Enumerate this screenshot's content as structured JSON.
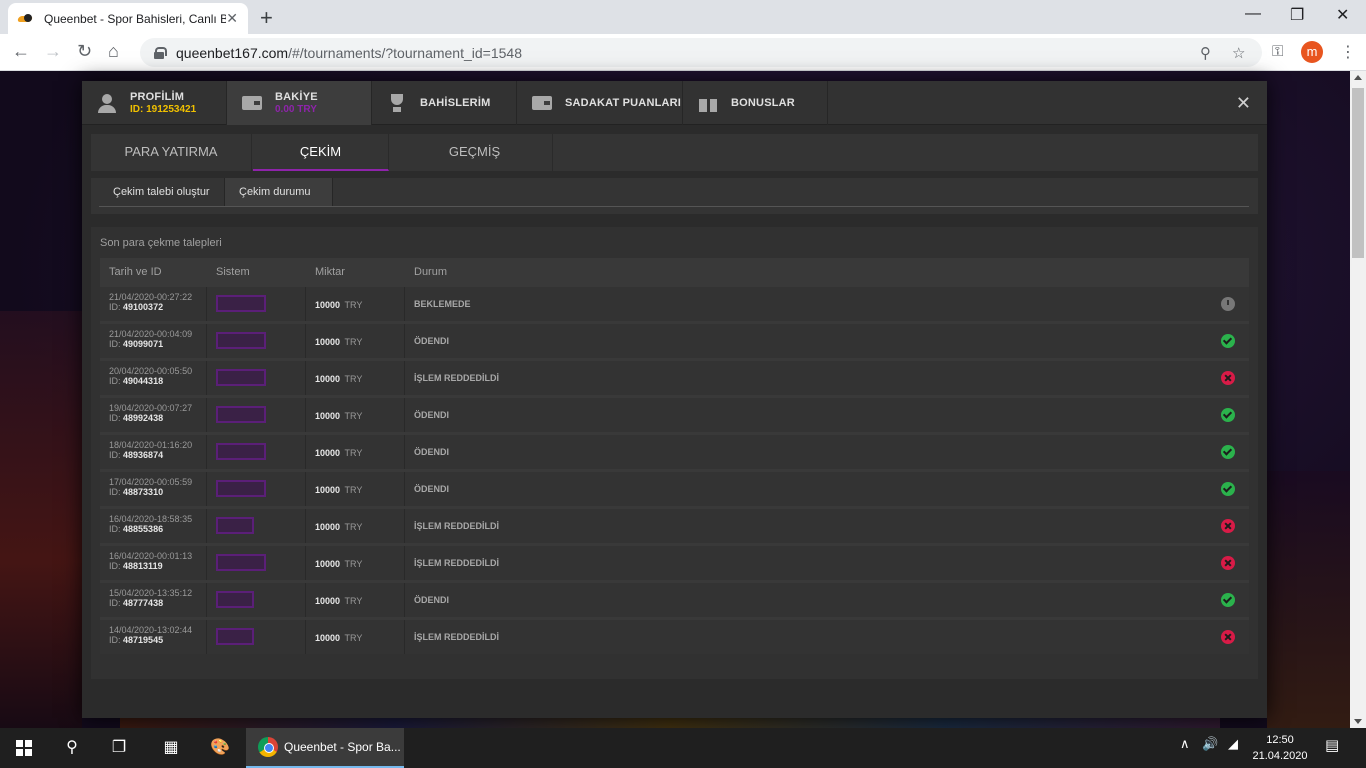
{
  "browser": {
    "tab_title": "Queenbet - Spor Bahisleri, Canlı B",
    "tab_close": "✕",
    "new_tab": "+",
    "url_host": "queenbet167.com",
    "url_path": "/#/tournaments/?tournament_id=1548",
    "profile_initial": "m",
    "minimize": "—",
    "maximize": "❐",
    "close": "✕"
  },
  "modal": {
    "topnav": [
      {
        "label": "PROFİLİM",
        "sub": "ID: 191253421",
        "icon": "user-icon"
      },
      {
        "label": "BAKİYE",
        "sub": "0.00 TRY",
        "icon": "wallet-icon"
      },
      {
        "label": "BAHİSLERİM",
        "icon": "trophy-icon"
      },
      {
        "label": "SADAKAT PUANLARI",
        "icon": "wallet-icon"
      },
      {
        "label": "BONUSLAR",
        "icon": "gift-icon"
      }
    ],
    "close_label": "✕",
    "subtabs": [
      "PARA YATIRMA",
      "ÇEKİM",
      "GEÇMİŞ"
    ],
    "actions": [
      "Çekim talebi oluştur",
      "Çekim durumu"
    ],
    "caption": "Son para çekme talepleri",
    "columns": [
      "Tarih ve ID",
      "Sistem",
      "Miktar",
      "Durum"
    ],
    "id_prefix": "ID:",
    "rows": [
      {
        "date": "21/04/2020-00:27:22",
        "id": "49100372",
        "amount": "10000",
        "currency": "TRY",
        "status": "BEKLEMEDE",
        "state": "pending"
      },
      {
        "date": "21/04/2020-00:04:09",
        "id": "49099071",
        "amount": "10000",
        "currency": "TRY",
        "status": "ÖDENDI",
        "state": "paid"
      },
      {
        "date": "20/04/2020-00:05:50",
        "id": "49044318",
        "amount": "10000",
        "currency": "TRY",
        "status": "İŞLEM REDDEDİLDİ",
        "state": "rejected"
      },
      {
        "date": "19/04/2020-00:07:27",
        "id": "48992438",
        "amount": "10000",
        "currency": "TRY",
        "status": "ÖDENDI",
        "state": "paid"
      },
      {
        "date": "18/04/2020-01:16:20",
        "id": "48936874",
        "amount": "10000",
        "currency": "TRY",
        "status": "ÖDENDI",
        "state": "paid"
      },
      {
        "date": "17/04/2020-00:05:59",
        "id": "48873310",
        "amount": "10000",
        "currency": "TRY",
        "status": "ÖDENDI",
        "state": "paid"
      },
      {
        "date": "16/04/2020-18:58:35",
        "id": "48855386",
        "amount": "10000",
        "currency": "TRY",
        "status": "İŞLEM REDDEDİLDİ",
        "state": "rejected"
      },
      {
        "date": "16/04/2020-00:01:13",
        "id": "48813119",
        "amount": "10000",
        "currency": "TRY",
        "status": "İŞLEM REDDEDİLDİ",
        "state": "rejected"
      },
      {
        "date": "15/04/2020-13:35:12",
        "id": "48777438",
        "amount": "10000",
        "currency": "TRY",
        "status": "ÖDENDI",
        "state": "paid"
      },
      {
        "date": "14/04/2020-13:02:44",
        "id": "48719545",
        "amount": "10000",
        "currency": "TRY",
        "status": "İŞLEM REDDEDİLDİ",
        "state": "rejected"
      }
    ]
  },
  "taskbar": {
    "app_label": "Queenbet - Spor Ba...",
    "time": "12:50",
    "date": "21.04.2020"
  },
  "colors": {
    "accent": "#8e24aa",
    "paid": "#2bb24c",
    "rejected": "#d81b47",
    "pending": "#777777"
  }
}
